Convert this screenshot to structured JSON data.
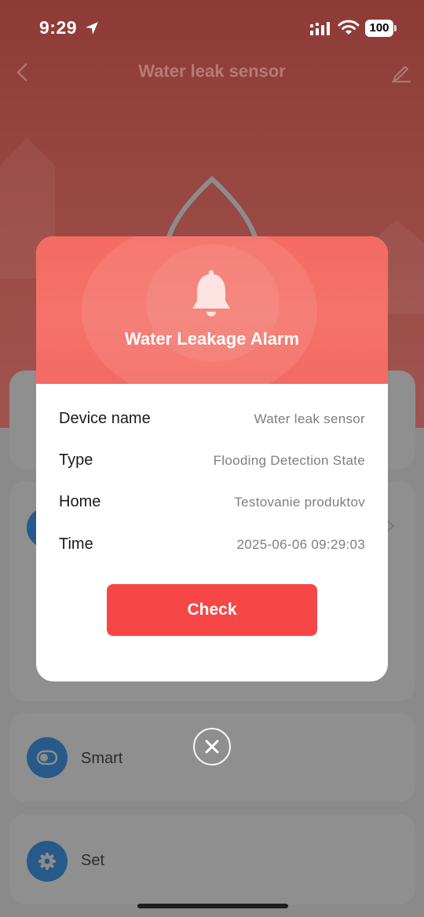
{
  "status_bar": {
    "time": "9:29",
    "battery": "100"
  },
  "nav": {
    "title": "Water leak sensor"
  },
  "background_cards": {
    "smart_label": "Smart",
    "set_label": "Set"
  },
  "alarm": {
    "title": "Water Leakage Alarm",
    "rows": [
      {
        "label": "Device name",
        "value": "Water leak sensor"
      },
      {
        "label": "Type",
        "value": "Flooding Detection State"
      },
      {
        "label": "Home",
        "value": "Testovanie produktov"
      },
      {
        "label": "Time",
        "value": "2025-06-06 09:29:03"
      }
    ],
    "check_label": "Check"
  },
  "colors": {
    "header_red": "#f46b62",
    "button_red": "#f64646",
    "card_icon_blue": "#27598a"
  },
  "icons": [
    "location-arrow-icon",
    "signal-icon",
    "wifi-icon",
    "battery-icon",
    "back-icon",
    "edit-icon",
    "water-drop-icon",
    "bell-icon",
    "toggle-icon",
    "gear-icon",
    "close-icon",
    "chevron-right-icon"
  ]
}
